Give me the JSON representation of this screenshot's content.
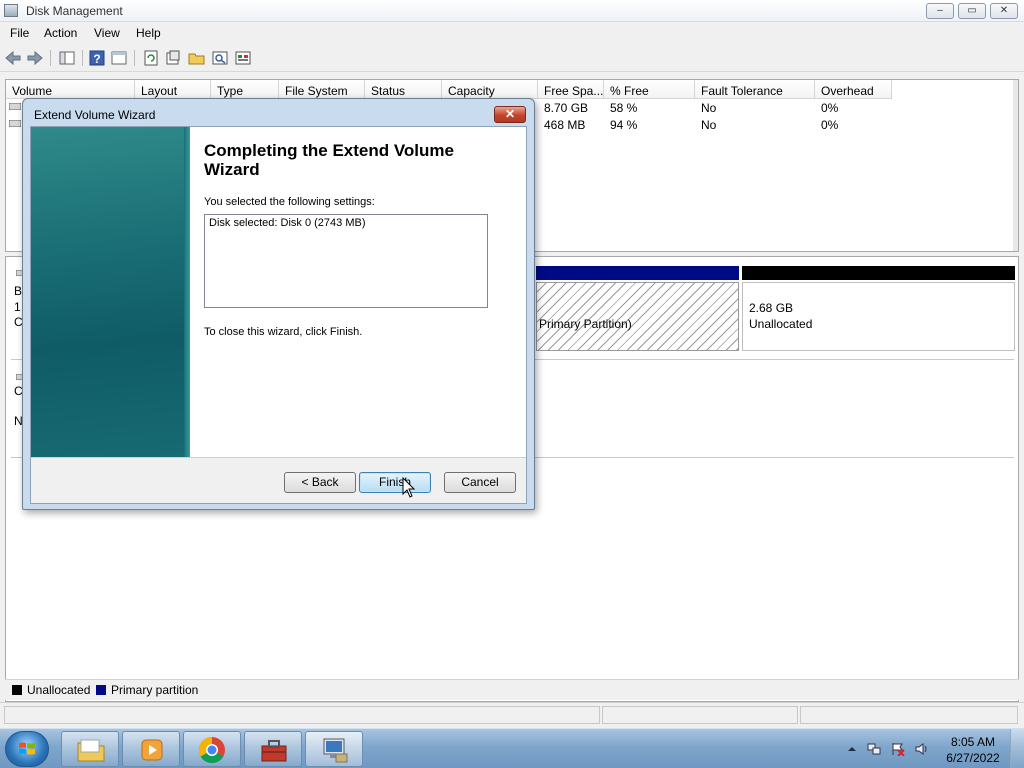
{
  "window": {
    "title": "Disk Management",
    "controls": {
      "minimize": "–",
      "maximize": "▭",
      "close": "✕"
    }
  },
  "menu": [
    "File",
    "Action",
    "View",
    "Help"
  ],
  "toolbar_icons": [
    "back-arrow-icon",
    "forward-arrow-icon",
    "console-tree-icon",
    "help-icon",
    "properties-icon",
    "refresh-icon",
    "rescan-icon",
    "open-icon",
    "search-icon",
    "disk-properties-icon"
  ],
  "volume_list": {
    "columns": [
      "Volume",
      "Layout",
      "Type",
      "File System",
      "Status",
      "Capacity",
      "Free Spa...",
      "% Free",
      "Fault Tolerance",
      "Overhead"
    ],
    "rows": [
      {
        "free": "8.70 GB",
        "pct_free": "58 %",
        "fault_tolerance": "No",
        "overhead": "0%"
      },
      {
        "free": "468 MB",
        "pct_free": "94 %",
        "fault_tolerance": "No",
        "overhead": "0%"
      }
    ]
  },
  "disk_area": {
    "disk0_partial_labels": [
      "B",
      "1",
      "C"
    ],
    "cdrom_partial_labels": [
      "C",
      "N"
    ],
    "primary_partition_text": "Primary Partition)",
    "unallocated_size": "2.68 GB",
    "unallocated_label": "Unallocated"
  },
  "legend": {
    "unallocated": "Unallocated",
    "primary": "Primary partition",
    "unallocated_color": "#000000",
    "primary_color": "#000a84"
  },
  "dialog": {
    "title": "Extend Volume Wizard",
    "heading": "Completing the Extend Volume Wizard",
    "settings_intro": "You selected the following settings:",
    "settings_value": "Disk selected: Disk 0 (2743 MB)",
    "close_hint": "To close this wizard, click Finish.",
    "buttons": {
      "back": "< Back",
      "finish": "Finish",
      "cancel": "Cancel"
    }
  },
  "taskbar": {
    "pinned": [
      "windows-explorer-icon",
      "media-player-icon",
      "chrome-icon",
      "toolbox-icon",
      "computer-management-icon"
    ],
    "tray_icons": [
      "show-hidden-icons-icon",
      "network-icon",
      "action-center-icon",
      "volume-icon"
    ],
    "time": "8:05 AM",
    "date": "6/27/2022"
  }
}
